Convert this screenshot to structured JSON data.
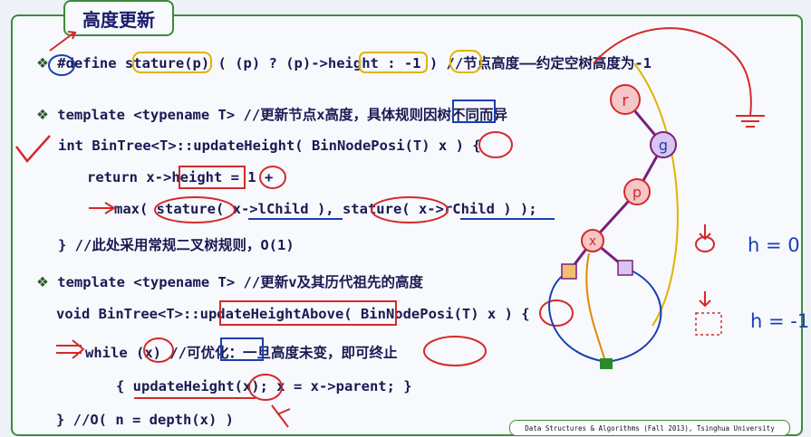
{
  "slide": {
    "title": "高度更新",
    "lines": {
      "define": "#define stature(p) ( (p) ? (p)->height : -1 ) //节点高度——约定空树高度为-1",
      "tmpl1": "template <typename T> //更新节点x高度，具体规则因树不同而异",
      "sig1": "int BinTree<T>::updateHeight( BinNodePosi(T) x ) {",
      "ret": "return x->height = 1 +",
      "max": "max( stature( x->lChild ), stature( x->rChild ) );",
      "end1": "} //此处采用常规二叉树规则，O(1)",
      "tmpl2": "template <typename T> //更新v及其历代祖先的高度",
      "sig2": "void BinTree<T>::updateHeightAbove( BinNodePosi(T) x ) {",
      "while": "while (x) //可优化：一旦高度未变，即可终止",
      "body": "{ updateHeight(x); x = x->parent; }",
      "end2": "} //O( n = depth(x) )"
    },
    "footer": "Data Structures & Algorithms (Fall 2013), Tsinghua University",
    "bullet_icon": "diamond-bullet-icon"
  },
  "annotations": {
    "tree_nodes": [
      "r",
      "g",
      "p",
      "x"
    ],
    "h_leaf": "h = 0",
    "h_empty": "h = -1"
  },
  "colors": {
    "ink_red": "#d42a2a",
    "ink_blue": "#1a3fb0",
    "ink_green": "#2b8a2b",
    "ink_orange": "#e08a00",
    "code_text": "#1a1a52"
  }
}
